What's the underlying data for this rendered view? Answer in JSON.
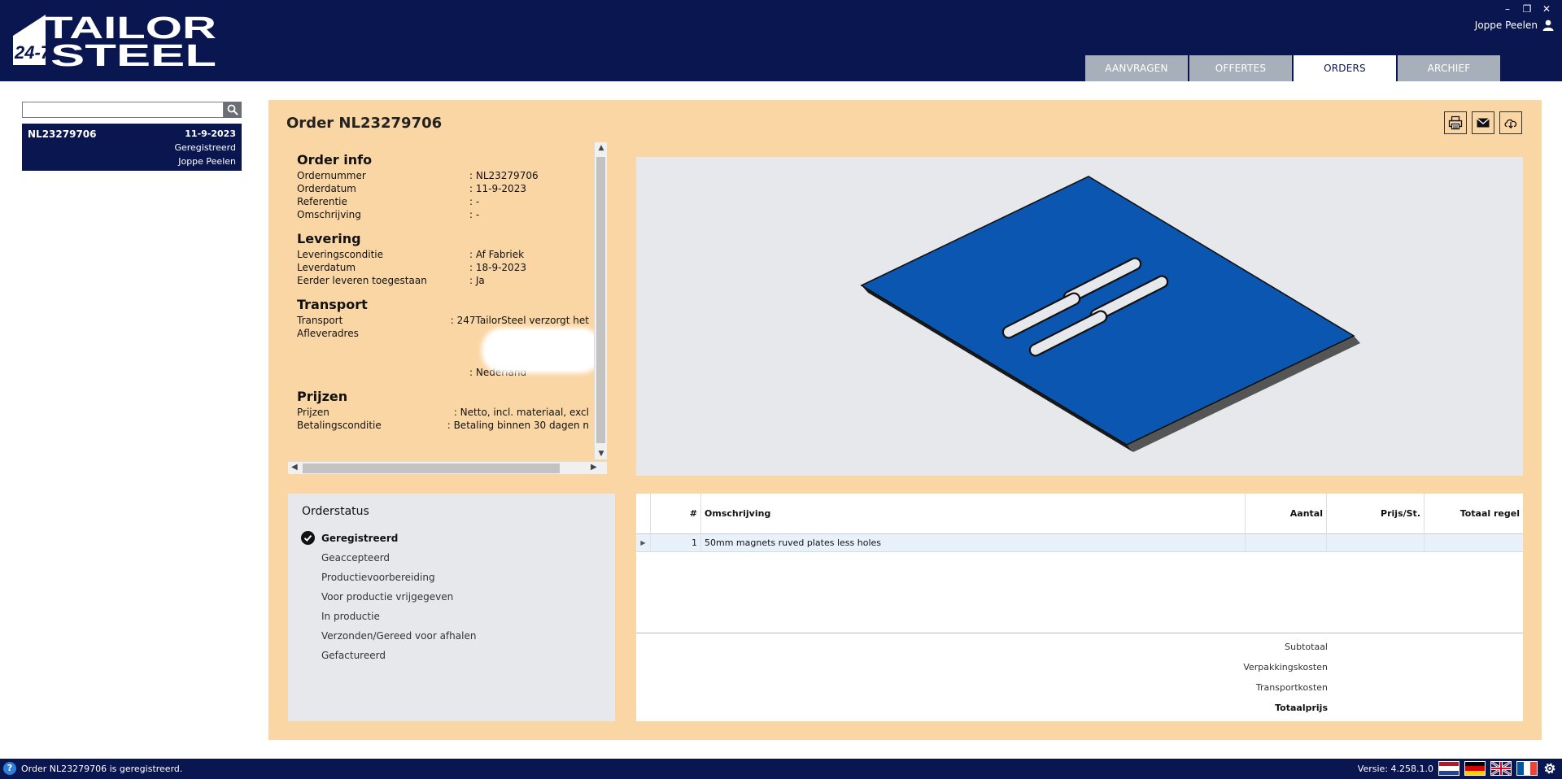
{
  "app": {
    "brand_top": "TAILOR",
    "brand_bottom": "STEEL",
    "brand_badge": "24-7",
    "user_name": "Joppe Peelen",
    "window_controls": [
      "–",
      "❐",
      "✕"
    ]
  },
  "tabs": [
    {
      "label": "AANVRAGEN",
      "active": false
    },
    {
      "label": "OFFERTES",
      "active": false
    },
    {
      "label": "ORDERS",
      "active": true
    },
    {
      "label": "ARCHIEF",
      "active": false
    }
  ],
  "sidebar": {
    "search_value": "",
    "orders": [
      {
        "number": "NL23279706",
        "date": "11-9-2023",
        "status": "Geregistreerd",
        "user": "Joppe Peelen"
      }
    ]
  },
  "order": {
    "title": "Order NL23279706",
    "sections": {
      "info": {
        "heading": "Order info",
        "rows": [
          {
            "k": "Ordernummer",
            "v": ": NL23279706"
          },
          {
            "k": "Orderdatum",
            "v": ": 11-9-2023"
          },
          {
            "k": "Referentie",
            "v": ": -"
          },
          {
            "k": "Omschrijving",
            "v": ": -"
          }
        ]
      },
      "levering": {
        "heading": "Levering",
        "rows": [
          {
            "k": "Leveringsconditie",
            "v": ": Af Fabriek"
          },
          {
            "k": "Leverdatum",
            "v": ": 18-9-2023"
          },
          {
            "k": "Eerder leveren toegestaan",
            "v": ": Ja"
          }
        ]
      },
      "transport": {
        "heading": "Transport",
        "rows": [
          {
            "k": "Transport",
            "v": ": 247TailorSteel verzorgt het"
          },
          {
            "k": "Afleveradres",
            "v": ""
          },
          {
            "k": "",
            "v": ""
          },
          {
            "k": "",
            "v": ""
          },
          {
            "k": "",
            "v": ": Nederland"
          }
        ]
      },
      "prijzen": {
        "heading": "Prijzen",
        "rows": [
          {
            "k": "Prijzen",
            "v": ": Netto, incl. materiaal, excl"
          },
          {
            "k": "Betalingsconditie",
            "v": ": Betaling binnen 30 dagen n"
          }
        ]
      }
    }
  },
  "orderstatus": {
    "heading": "Orderstatus",
    "steps": [
      {
        "label": "Geregistreerd",
        "current": true
      },
      {
        "label": "Geaccepteerd",
        "current": false
      },
      {
        "label": "Productievoorbereiding",
        "current": false
      },
      {
        "label": "Voor productie vrijgegeven",
        "current": false
      },
      {
        "label": "In productie",
        "current": false
      },
      {
        "label": "Verzonden/Gereed voor afhalen",
        "current": false
      },
      {
        "label": "Gefactureerd",
        "current": false
      }
    ]
  },
  "lines": {
    "columns": [
      "#",
      "Omschrijving",
      "Aantal",
      "Prijs/St.",
      "Totaal regel"
    ],
    "rows": [
      {
        "nr": "1",
        "description": "50mm magnets ruved plates less holes",
        "qty": "",
        "price": "",
        "total": ""
      }
    ],
    "totals": {
      "subtotaal": "Subtotaal",
      "verpakking": "Verpakkingskosten",
      "transport": "Transportkosten",
      "totaal": "Totaalprijs"
    }
  },
  "statusbar": {
    "message": "Order NL23279706 is geregistreerd.",
    "version": "Versie: 4.258.1.0",
    "languages": [
      "nl",
      "de",
      "en",
      "fr"
    ]
  },
  "colors": {
    "navy": "#0a1650",
    "panel": "#fbd6a5",
    "plate": "#0b56b0",
    "tab_inactive": "#a7b0ba"
  }
}
